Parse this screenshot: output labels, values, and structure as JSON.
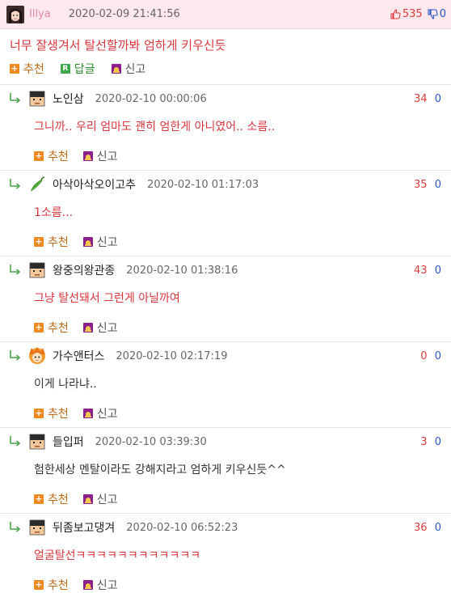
{
  "post": {
    "author": "Illya",
    "date": "2020-02-09 21:41:56",
    "up_count": "535",
    "down_count": "0",
    "title": "너무 잘생겨서 탈선할까봐 엄하게 키우신듯",
    "actions": {
      "recommend": "추천",
      "reply": "답글",
      "report": "신고"
    }
  },
  "comment_actions": {
    "recommend": "추천",
    "report": "신고"
  },
  "comments": [
    {
      "name": "노인삼",
      "date": "2020-02-10 00:00:06",
      "up": "34",
      "down": "0",
      "text": "그니까.. 우리 엄마도 괜히 엄한게 아니였어.. 소름..",
      "avatar": "pixel-man-icon"
    },
    {
      "name": "아삭아삭오이고추",
      "date": "2020-02-10 01:17:03",
      "up": "35",
      "down": "0",
      "text": "1소름...",
      "avatar": "green-pepper-icon"
    },
    {
      "name": "왕중의왕관종",
      "date": "2020-02-10 01:38:16",
      "up": "43",
      "down": "0",
      "text": "그냥 탈선돼서 그런게 아닐까여",
      "avatar": "pixel-man-icon"
    },
    {
      "name": "가수앤터스",
      "date": "2020-02-10 02:17:19",
      "up": "0",
      "down": "0",
      "text": "이게 나라냐..",
      "avatar": "anime-face-icon"
    },
    {
      "name": "들입퍼",
      "date": "2020-02-10 03:39:30",
      "up": "3",
      "down": "0",
      "text": "험한세상 멘탈이라도 강해지라고 엄하게 키우신듯^^",
      "avatar": "pixel-man-icon"
    },
    {
      "name": "뒤좀보고댕겨",
      "date": "2020-02-10 06:52:23",
      "up": "36",
      "down": "0",
      "text": "얼굴탈선ㅋㅋㅋㅋㅋㅋㅋㅋㅋㅋㅋㅋ",
      "avatar": "pixel-man-icon"
    }
  ],
  "colors": {
    "title_red": "#d9363c",
    "up_red": "#e03a3a",
    "down_blue": "#2b56c8",
    "header_pink": "#fde8ee"
  }
}
